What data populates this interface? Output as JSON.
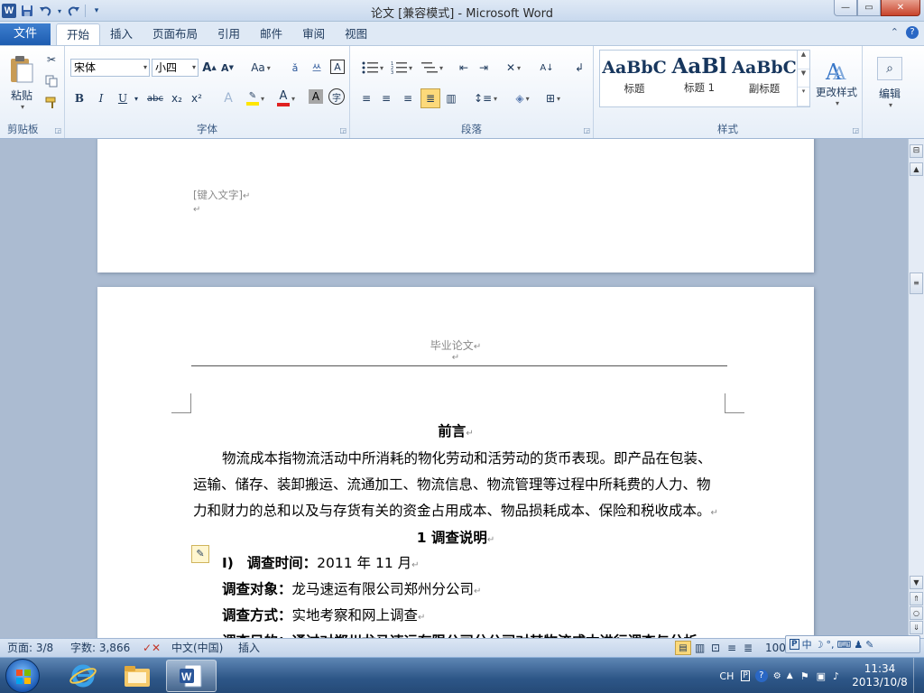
{
  "window": {
    "title": "论文 [兼容模式] - Microsoft Word",
    "app_logo": "W"
  },
  "ribbon_tabs": {
    "file": "文件",
    "tabs": [
      "开始",
      "插入",
      "页面布局",
      "引用",
      "邮件",
      "审阅",
      "视图"
    ]
  },
  "clipboard": {
    "paste_label": "粘贴",
    "group_label": "剪贴板"
  },
  "font": {
    "name": "宋体",
    "size": "小四",
    "grow": "A",
    "shrink": "A",
    "change_case": "Aa",
    "bold": "B",
    "italic": "I",
    "underline": "U",
    "strike": "abc",
    "subscript": "x₂",
    "superscript": "x²",
    "font_color_letter": "A",
    "char_shading_letter": "A",
    "enclose_char": "字",
    "group_label": "字体"
  },
  "paragraph": {
    "group_label": "段落"
  },
  "styles": {
    "items": [
      {
        "sample": "AaBbC",
        "name": "标题"
      },
      {
        "sample": "AaBl",
        "name": "标题 1"
      },
      {
        "sample": "AaBbC",
        "name": "副标题"
      }
    ],
    "change_styles": "更改样式",
    "group_label": "样式"
  },
  "editing": {
    "label": "编辑"
  },
  "document": {
    "page1_placeholder": "[键入文字]",
    "header_text": "毕业论文",
    "heading_preface": "前言",
    "preface_lines": [
      "物流成本指物流活动中所消耗的物化劳动和活劳动的货币表现。即产品在包装、",
      "运输、储存、装卸搬运、流通加工、物流信息、物流管理等过程中所耗费的人力、物",
      "力和财力的总和以及与存货有关的资金占用成本、物品损耗成本、保险和税收成本。"
    ],
    "section1_heading": "1 调查说明",
    "list_marker": "I)",
    "survey_time_label": "调查时间：",
    "survey_time_value": "2011 年 11 月",
    "survey_object_label": "调查对象：",
    "survey_object_value": "龙马速运有限公司郑州分公司",
    "survey_method_label": "调查方式：",
    "survey_method_value": "实地考察和网上调查",
    "partial_line": "调查目的：通过对郑州龙马速运有限公司分公司对其物流成本进行调查与分析"
  },
  "statusbar": {
    "page": "页面: 3/8",
    "words": "字数: 3,866",
    "language": "中文(中国)",
    "mode": "插入",
    "zoom": "100"
  },
  "taskbar": {
    "input_lang": "CH",
    "time": "11:34",
    "date": "2013/10/8"
  },
  "ime": {
    "items": [
      "中",
      "°,"
    ]
  }
}
